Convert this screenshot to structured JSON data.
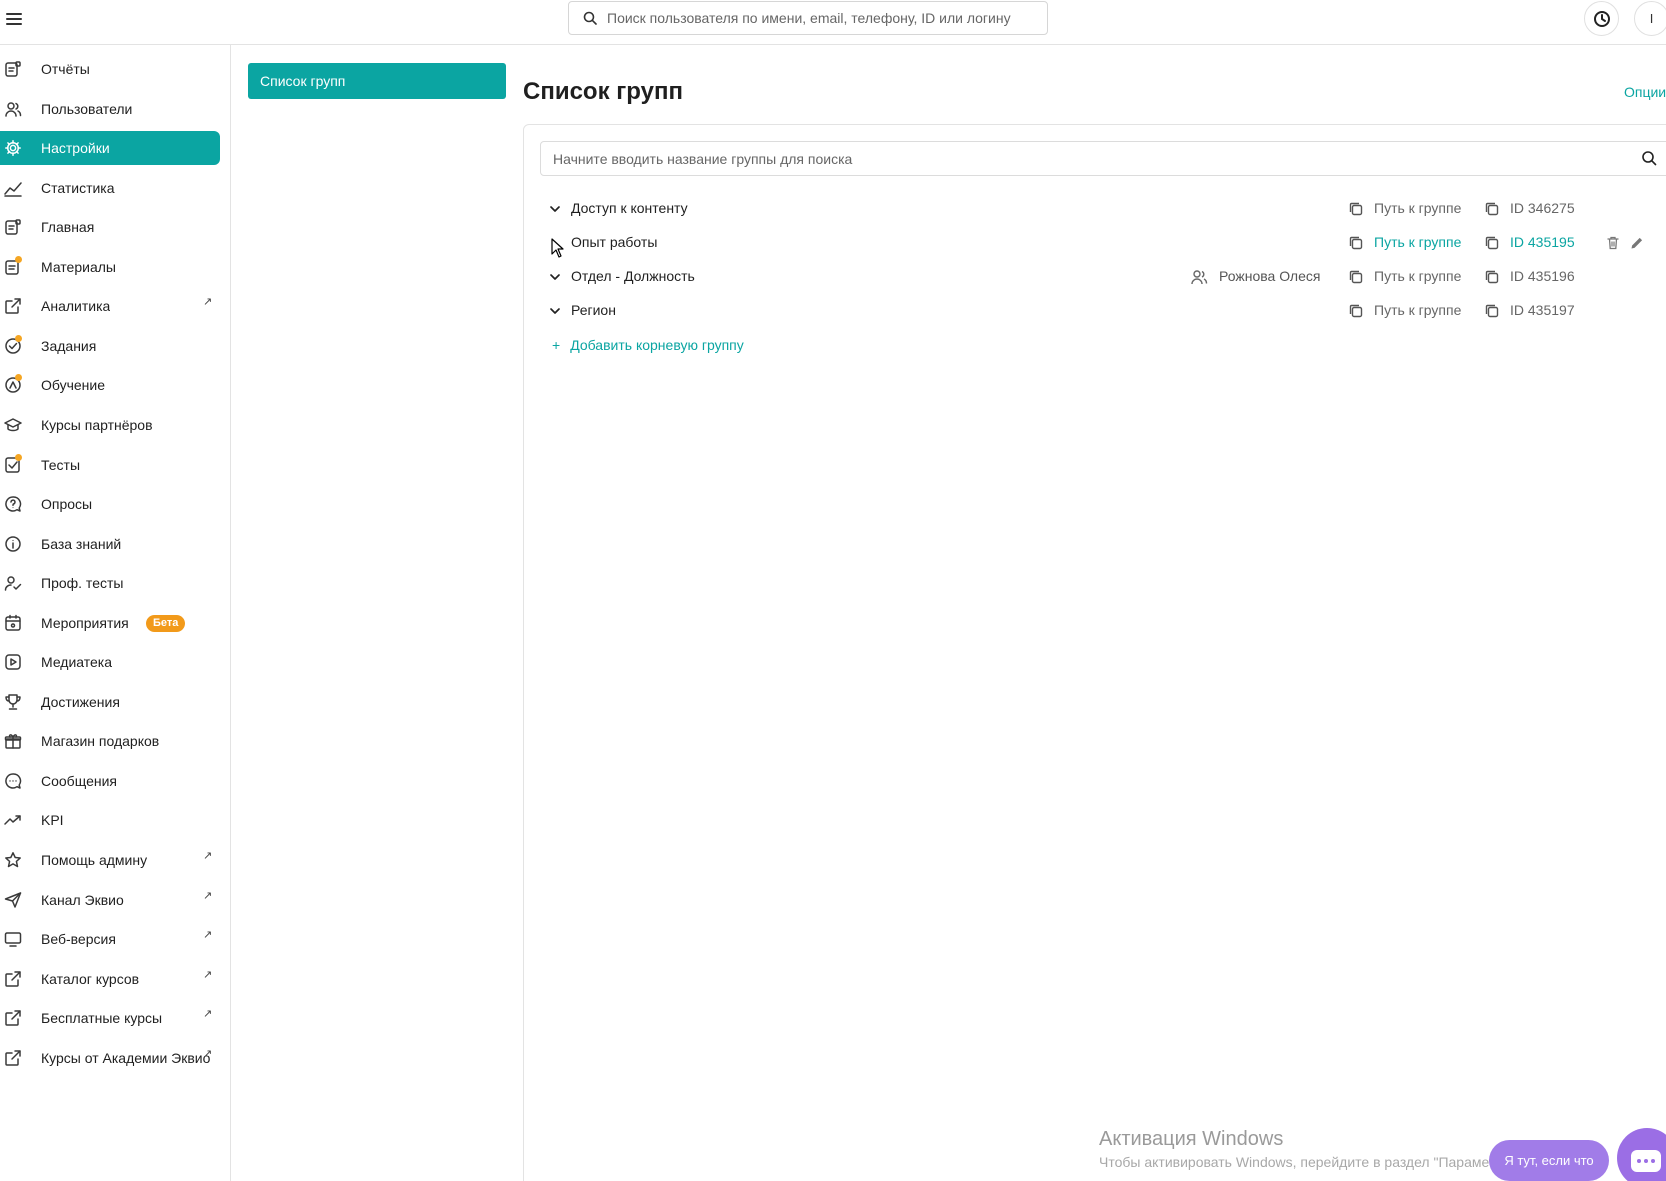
{
  "topbar": {
    "search_placeholder": "Поиск пользователя по имени, email, телефону, ID или логину",
    "profile_initial": "I"
  },
  "sidebar": {
    "items": [
      {
        "label": "Отчёты",
        "icon": "report-icon"
      },
      {
        "label": "Пользователи",
        "icon": "users-icon"
      },
      {
        "label": "Настройки",
        "icon": "gear-icon",
        "active": true
      },
      {
        "label": "Статистика",
        "icon": "chart-line-icon"
      },
      {
        "label": "Главная",
        "icon": "home-doc-icon"
      },
      {
        "label": "Материалы",
        "icon": "materials-icon",
        "dot": true
      },
      {
        "label": "Аналитика",
        "icon": "external-link-icon",
        "external": true
      },
      {
        "label": "Задания",
        "icon": "task-check-icon",
        "dot": true
      },
      {
        "label": "Обучение",
        "icon": "learning-icon",
        "dot": true
      },
      {
        "label": "Курсы партнёров",
        "icon": "graduation-cap-icon"
      },
      {
        "label": "Тесты",
        "icon": "test-check-icon",
        "dot": true
      },
      {
        "label": "Опросы",
        "icon": "question-bubble-icon"
      },
      {
        "label": "База знаний",
        "icon": "info-icon"
      },
      {
        "label": "Проф. тесты",
        "icon": "user-check-icon"
      },
      {
        "label": "Мероприятия",
        "icon": "calendar-icon",
        "badge": "Бета"
      },
      {
        "label": "Медиатека",
        "icon": "play-icon"
      },
      {
        "label": "Достижения",
        "icon": "trophy-icon"
      },
      {
        "label": "Магазин подарков",
        "icon": "gift-icon"
      },
      {
        "label": "Сообщения",
        "icon": "chat-icon"
      },
      {
        "label": "KPI",
        "icon": "trend-icon"
      },
      {
        "label": "Помощь админу",
        "icon": "star-icon",
        "external": true
      },
      {
        "label": "Канал Эквио",
        "icon": "send-icon",
        "external": true
      },
      {
        "label": "Веб-версия",
        "icon": "monitor-icon",
        "external": true
      },
      {
        "label": "Каталог курсов",
        "icon": "external-link-icon",
        "external": true
      },
      {
        "label": "Бесплатные курсы",
        "icon": "external-link-icon",
        "external": true
      },
      {
        "label": "Курсы от Академии Эквио",
        "icon": "external-link-icon",
        "external": true
      }
    ],
    "external_glyph": "↗"
  },
  "subnav": {
    "active_label": "Список групп"
  },
  "main": {
    "title": "Список групп",
    "options_label": "Опции",
    "group_search_placeholder": "Начните вводить название группы для поиска",
    "groups": [
      {
        "name": "Доступ к контенту",
        "owner": "",
        "path_label": "Путь к группе",
        "id_label": "ID 346275"
      },
      {
        "name": "Опыт работы",
        "owner": "",
        "path_label": "Путь к группе",
        "id_label": "ID 435195",
        "hover": true
      },
      {
        "name": "Отдел - Должность",
        "owner": "Рожнова Олеся",
        "path_label": "Путь к группе",
        "id_label": "ID 435196"
      },
      {
        "name": "Регион",
        "owner": "",
        "path_label": "Путь к группе",
        "id_label": "ID 435197"
      }
    ],
    "add_root_plus": "+",
    "add_root_label": "Добавить корневую группу"
  },
  "watermark": {
    "title": "Активация Windows",
    "subtitle": "Чтобы активировать Windows, перейдите в раздел \"Параметры\"."
  },
  "chat": {
    "pill_label": "Я тут, если что"
  },
  "colors": {
    "accent": "#0ba5a2",
    "badge": "#f29a1a",
    "dot": "#f5a623",
    "chat": "#9b6ee5"
  }
}
